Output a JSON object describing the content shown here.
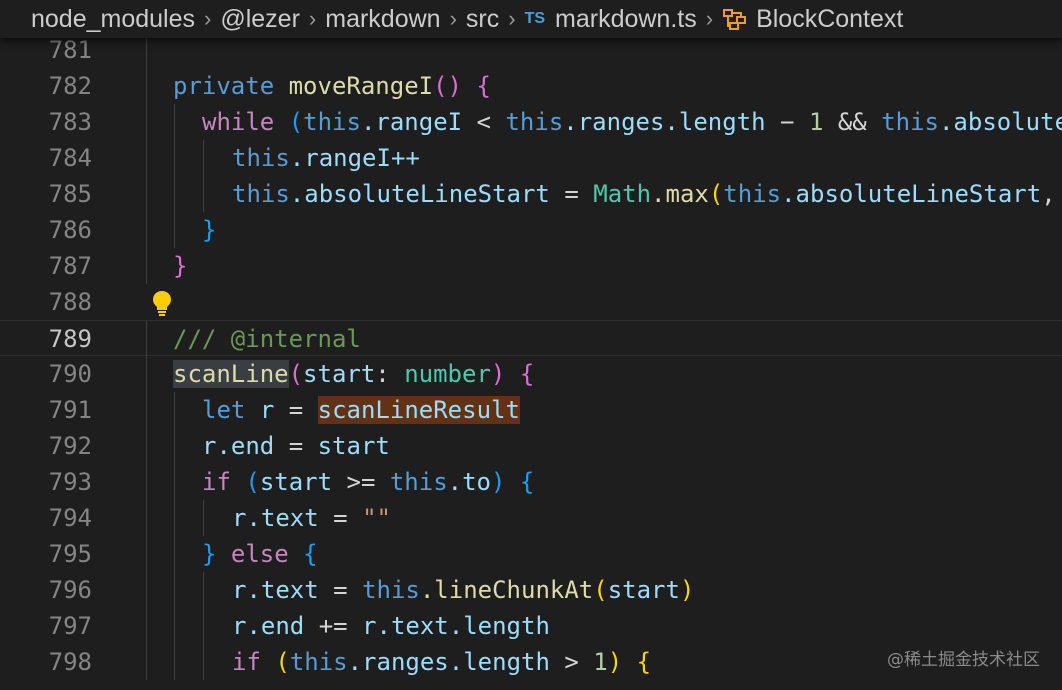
{
  "breadcrumb": {
    "items": [
      "node_modules",
      "@lezer",
      "markdown",
      "src"
    ],
    "file_badge": "TS",
    "file": "markdown.ts",
    "symbol": "BlockContext",
    "separator": "›"
  },
  "line_numbers": [
    "781",
    "782",
    "783",
    "784",
    "785",
    "786",
    "787",
    "788",
    "789",
    "790",
    "791",
    "792",
    "793",
    "794",
    "795",
    "796",
    "797",
    "798"
  ],
  "active_line": "789",
  "code": {
    "l782": {
      "private": "private",
      "method": "moveRangeI",
      "paren": "()",
      "brace": "{"
    },
    "l783": {
      "while": "while",
      "p_open": "(",
      "this1": "this",
      "rangeI": ".rangeI",
      "lt": " < ",
      "this2": "this",
      "ranges": ".ranges",
      "length": ".length",
      "minus": " − ",
      "one": "1",
      "and": " && ",
      "this3": "this",
      "absolute": ".absolute"
    },
    "l784": {
      "this": "this",
      "rest": ".rangeI++"
    },
    "l785": {
      "this1": "this",
      "absStart": ".absoluteLineStart",
      "eq": " = ",
      "math": "Math",
      "max": ".max",
      "p_open": "(",
      "this2": "this",
      "absStart2": ".absoluteLineStart",
      "comma": ","
    },
    "l786": {
      "brace": "}"
    },
    "l787": {
      "brace": "}"
    },
    "l789": {
      "comment": "/// @internal"
    },
    "l790": {
      "fn": "scanLine",
      "p_open": "(",
      "param": "start",
      "colon": ": ",
      "type": "number",
      "p_close": ")",
      "brace": "{"
    },
    "l791": {
      "let": "let",
      "r": "r",
      "eq": " = ",
      "result": "scanLineResult"
    },
    "l792": {
      "r": "r",
      "end": ".end",
      "eq": " = ",
      "start": "start"
    },
    "l793": {
      "if": "if",
      "p_open": "(",
      "start": "start",
      "gte": " >= ",
      "this": "this",
      "to": ".to",
      "p_close": ")",
      "brace": "{"
    },
    "l794": {
      "r": "r",
      "text": ".text",
      "eq": " = ",
      "str": "\"\""
    },
    "l795": {
      "brace": "}",
      "else": "else",
      "brace2": "{"
    },
    "l796": {
      "r": "r",
      "text": ".text",
      "eq": " = ",
      "this": "this",
      "fn": ".lineChunkAt",
      "p_open": "(",
      "start": "start",
      "p_close": ")"
    },
    "l797": {
      "r": "r",
      "end": ".end",
      "op": " += ",
      "r2": "r",
      "text": ".text",
      "length": ".length"
    },
    "l798": {
      "if": "if",
      "p_open": "(",
      "this": "this",
      "ranges": ".ranges",
      "length": ".length",
      "gt": " > ",
      "one": "1",
      "p_close": ")",
      "brace": "{"
    }
  },
  "watermark": "@稀土掘金技术社区"
}
